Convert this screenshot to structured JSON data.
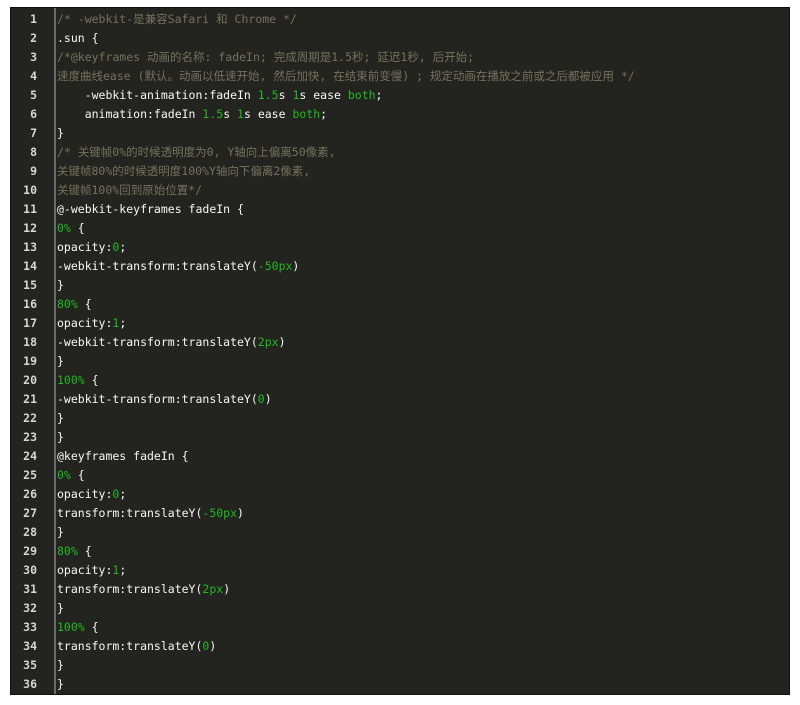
{
  "colors": {
    "background": "#23241f",
    "text": "#f8f8f2",
    "comment": "#75715e",
    "number": "#22b922",
    "gutter_rule": "#6b6b6b"
  },
  "lines": [
    {
      "n": "1",
      "segs": [
        {
          "c": "c",
          "t": "/* -webkit-是兼容Safari 和 Chrome */"
        }
      ]
    },
    {
      "n": "2",
      "segs": [
        {
          "c": "t",
          "t": ".sun {"
        }
      ]
    },
    {
      "n": "3",
      "segs": [
        {
          "c": "c",
          "t": "/*@keyframes 动画的名称: fadeIn; 完成周期是1.5秒; 延迟1秒, 后开始;"
        }
      ]
    },
    {
      "n": "4",
      "segs": [
        {
          "c": "c",
          "t": "速度曲线ease (默认。动画以低速开始, 然后加快, 在结束前变慢) ; 规定动画在播放之前或之后都被应用 */"
        }
      ]
    },
    {
      "n": "5",
      "segs": [
        {
          "c": "t",
          "t": "    -webkit-animation:fadeIn "
        },
        {
          "c": "n",
          "t": "1.5"
        },
        {
          "c": "t",
          "t": "s "
        },
        {
          "c": "n",
          "t": "1"
        },
        {
          "c": "t",
          "t": "s ease "
        },
        {
          "c": "k",
          "t": "both"
        },
        {
          "c": "t",
          "t": ";"
        }
      ]
    },
    {
      "n": "6",
      "segs": [
        {
          "c": "t",
          "t": "    animation:fadeIn "
        },
        {
          "c": "n",
          "t": "1.5"
        },
        {
          "c": "t",
          "t": "s "
        },
        {
          "c": "n",
          "t": "1"
        },
        {
          "c": "t",
          "t": "s ease "
        },
        {
          "c": "k",
          "t": "both"
        },
        {
          "c": "t",
          "t": ";"
        }
      ]
    },
    {
      "n": "7",
      "segs": [
        {
          "c": "t",
          "t": "}"
        }
      ]
    },
    {
      "n": "8",
      "segs": [
        {
          "c": "c",
          "t": "/* 关键帧0%的时候透明度为0, Y轴向上偏离50像素,"
        }
      ]
    },
    {
      "n": "9",
      "segs": [
        {
          "c": "c",
          "t": "关键帧80%的时候透明度100%Y轴向下偏离2像素,"
        }
      ]
    },
    {
      "n": "10",
      "segs": [
        {
          "c": "c",
          "t": "关键帧100%回到原始位置*/"
        }
      ]
    },
    {
      "n": "11",
      "segs": [
        {
          "c": "t",
          "t": "@-webkit-keyframes fadeIn {"
        }
      ]
    },
    {
      "n": "12",
      "segs": [
        {
          "c": "n",
          "t": "0%"
        },
        {
          "c": "t",
          "t": " {"
        }
      ]
    },
    {
      "n": "13",
      "segs": [
        {
          "c": "t",
          "t": "opacity:"
        },
        {
          "c": "n",
          "t": "0"
        },
        {
          "c": "t",
          "t": ";"
        }
      ]
    },
    {
      "n": "14",
      "segs": [
        {
          "c": "t",
          "t": "-webkit-transform:translateY("
        },
        {
          "c": "n",
          "t": "-50px"
        },
        {
          "c": "t",
          "t": ")"
        }
      ]
    },
    {
      "n": "15",
      "segs": [
        {
          "c": "t",
          "t": "}"
        }
      ]
    },
    {
      "n": "16",
      "segs": [
        {
          "c": "n",
          "t": "80%"
        },
        {
          "c": "t",
          "t": " {"
        }
      ]
    },
    {
      "n": "17",
      "segs": [
        {
          "c": "t",
          "t": "opacity:"
        },
        {
          "c": "n",
          "t": "1"
        },
        {
          "c": "t",
          "t": ";"
        }
      ]
    },
    {
      "n": "18",
      "segs": [
        {
          "c": "t",
          "t": "-webkit-transform:translateY("
        },
        {
          "c": "n",
          "t": "2px"
        },
        {
          "c": "t",
          "t": ")"
        }
      ]
    },
    {
      "n": "19",
      "segs": [
        {
          "c": "t",
          "t": "}"
        }
      ]
    },
    {
      "n": "20",
      "segs": [
        {
          "c": "n",
          "t": "100%"
        },
        {
          "c": "t",
          "t": " {"
        }
      ]
    },
    {
      "n": "21",
      "segs": [
        {
          "c": "t",
          "t": "-webkit-transform:translateY("
        },
        {
          "c": "n",
          "t": "0"
        },
        {
          "c": "t",
          "t": ")"
        }
      ]
    },
    {
      "n": "22",
      "segs": [
        {
          "c": "t",
          "t": "}"
        }
      ]
    },
    {
      "n": "23",
      "segs": [
        {
          "c": "t",
          "t": "}"
        }
      ]
    },
    {
      "n": "24",
      "segs": [
        {
          "c": "t",
          "t": "@keyframes fadeIn {"
        }
      ]
    },
    {
      "n": "25",
      "segs": [
        {
          "c": "n",
          "t": "0%"
        },
        {
          "c": "t",
          "t": " {"
        }
      ]
    },
    {
      "n": "26",
      "segs": [
        {
          "c": "t",
          "t": "opacity:"
        },
        {
          "c": "n",
          "t": "0"
        },
        {
          "c": "t",
          "t": ";"
        }
      ]
    },
    {
      "n": "27",
      "segs": [
        {
          "c": "t",
          "t": "transform:translateY("
        },
        {
          "c": "n",
          "t": "-50px"
        },
        {
          "c": "t",
          "t": ")"
        }
      ]
    },
    {
      "n": "28",
      "segs": [
        {
          "c": "t",
          "t": "}"
        }
      ]
    },
    {
      "n": "29",
      "segs": [
        {
          "c": "n",
          "t": "80%"
        },
        {
          "c": "t",
          "t": " {"
        }
      ]
    },
    {
      "n": "30",
      "segs": [
        {
          "c": "t",
          "t": "opacity:"
        },
        {
          "c": "n",
          "t": "1"
        },
        {
          "c": "t",
          "t": ";"
        }
      ]
    },
    {
      "n": "31",
      "segs": [
        {
          "c": "t",
          "t": "transform:translateY("
        },
        {
          "c": "n",
          "t": "2px"
        },
        {
          "c": "t",
          "t": ")"
        }
      ]
    },
    {
      "n": "32",
      "segs": [
        {
          "c": "t",
          "t": "}"
        }
      ]
    },
    {
      "n": "33",
      "segs": [
        {
          "c": "n",
          "t": "100%"
        },
        {
          "c": "t",
          "t": " {"
        }
      ]
    },
    {
      "n": "34",
      "segs": [
        {
          "c": "t",
          "t": "transform:translateY("
        },
        {
          "c": "n",
          "t": "0"
        },
        {
          "c": "t",
          "t": ")"
        }
      ]
    },
    {
      "n": "35",
      "segs": [
        {
          "c": "t",
          "t": "}"
        }
      ]
    },
    {
      "n": "36",
      "segs": [
        {
          "c": "t",
          "t": "}"
        }
      ]
    }
  ]
}
